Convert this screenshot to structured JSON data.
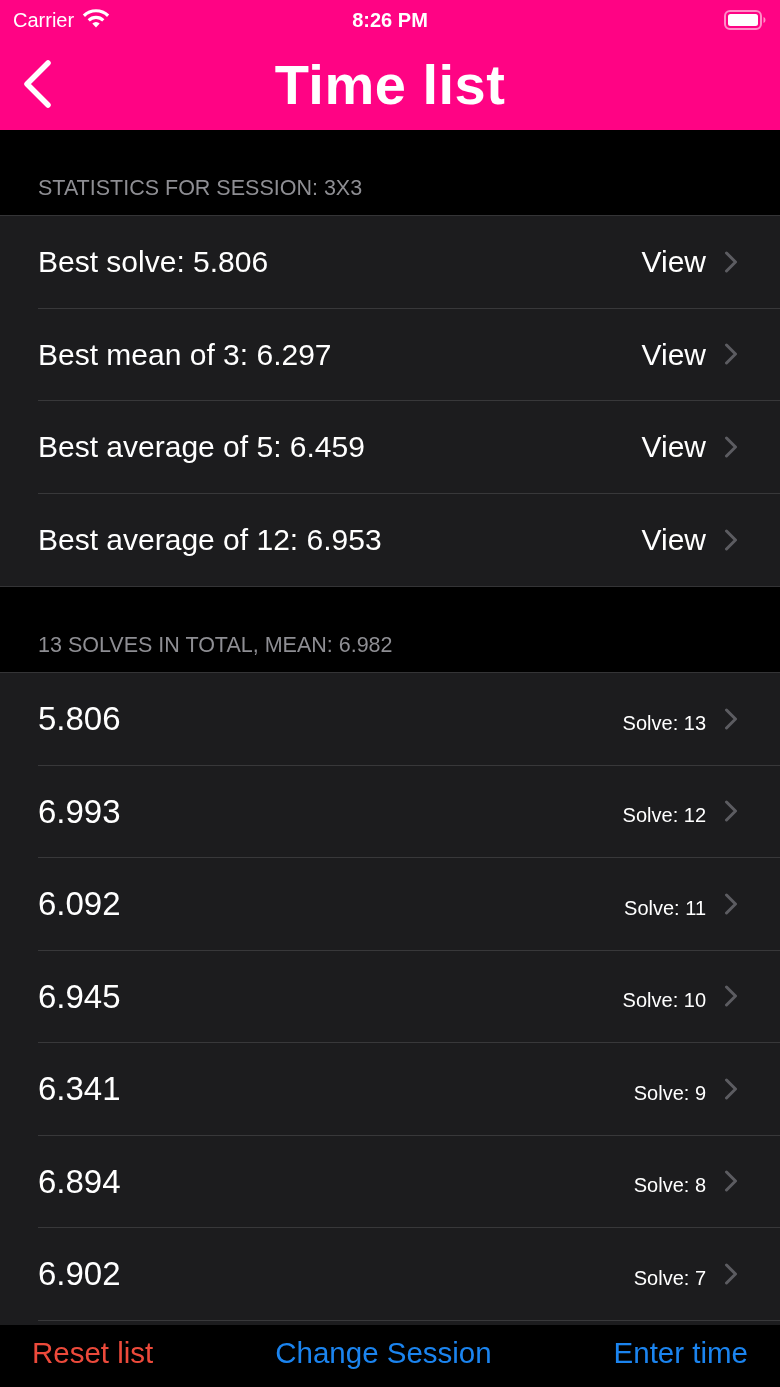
{
  "status_bar": {
    "carrier": "Carrier",
    "time": "8:26 PM"
  },
  "nav_bar": {
    "title": "Time list"
  },
  "sections": [
    {
      "header": "STATISTICS FOR SESSION: 3X3",
      "kind": "stats",
      "rows": [
        {
          "label": "Best solve: 5.806",
          "detail": "View"
        },
        {
          "label": "Best mean of 3: 6.297",
          "detail": "View"
        },
        {
          "label": "Best average of 5: 6.459",
          "detail": "View"
        },
        {
          "label": "Best average of 12: 6.953",
          "detail": "View"
        }
      ]
    },
    {
      "header": "13 SOLVES IN TOTAL, MEAN: 6.982",
      "kind": "solves",
      "rows": [
        {
          "label": "5.806",
          "detail": "Solve: 13"
        },
        {
          "label": "6.993",
          "detail": "Solve: 12"
        },
        {
          "label": "6.092",
          "detail": "Solve: 11"
        },
        {
          "label": "6.945",
          "detail": "Solve: 10"
        },
        {
          "label": "6.341",
          "detail": "Solve: 9"
        },
        {
          "label": "6.894",
          "detail": "Solve: 8"
        },
        {
          "label": "6.902",
          "detail": "Solve: 7"
        }
      ]
    }
  ],
  "toolbar": {
    "buttons": [
      {
        "label": "Reset list",
        "kind": "destructive"
      },
      {
        "label": "Change Session",
        "kind": "normal"
      },
      {
        "label": "Enter time",
        "kind": "normal"
      }
    ]
  }
}
